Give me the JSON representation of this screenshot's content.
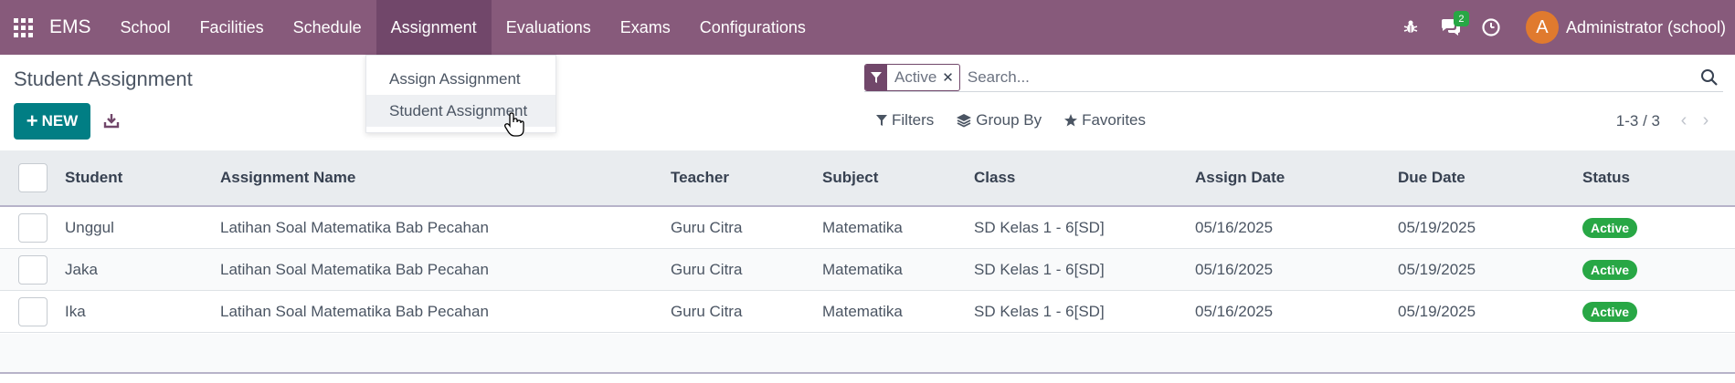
{
  "navbar": {
    "brand": "EMS",
    "menu": [
      "School",
      "Facilities",
      "Schedule",
      "Assignment",
      "Evaluations",
      "Exams",
      "Configurations"
    ],
    "active_menu": "Assignment",
    "messages_count": "2",
    "user": {
      "initial": "A",
      "name": "Administrator (school)"
    },
    "color": "#875a7b"
  },
  "control_panel": {
    "title": "Student Assignment",
    "new_label": "NEW",
    "search": {
      "facet": "Active",
      "placeholder": "Search..."
    },
    "filters_label": "Filters",
    "group_by_label": "Group By",
    "favorites_label": "Favorites",
    "pager": "1-3 / 3"
  },
  "dropdown": {
    "items": [
      "Assign Assignment",
      "Student Assignment"
    ]
  },
  "table": {
    "columns": [
      "Student",
      "Assignment Name",
      "Teacher",
      "Subject",
      "Class",
      "Assign Date",
      "Due Date",
      "Status"
    ],
    "rows": [
      {
        "student": "Unggul",
        "name": "Latihan Soal Matematika Bab Pecahan",
        "teacher": "Guru Citra",
        "subject": "Matematika",
        "class": "SD Kelas 1 - 6[SD]",
        "assign_date": "05/16/2025",
        "due_date": "05/19/2025",
        "status": "Active"
      },
      {
        "student": "Jaka",
        "name": "Latihan Soal Matematika Bab Pecahan",
        "teacher": "Guru Citra",
        "subject": "Matematika",
        "class": "SD Kelas 1 - 6[SD]",
        "assign_date": "05/16/2025",
        "due_date": "05/19/2025",
        "status": "Active"
      },
      {
        "student": "Ika",
        "name": "Latihan Soal Matematika Bab Pecahan",
        "teacher": "Guru Citra",
        "subject": "Matematika",
        "class": "SD Kelas 1 - 6[SD]",
        "assign_date": "05/16/2025",
        "due_date": "05/19/2025",
        "status": "Active"
      }
    ],
    "status_color": "#28a745"
  }
}
